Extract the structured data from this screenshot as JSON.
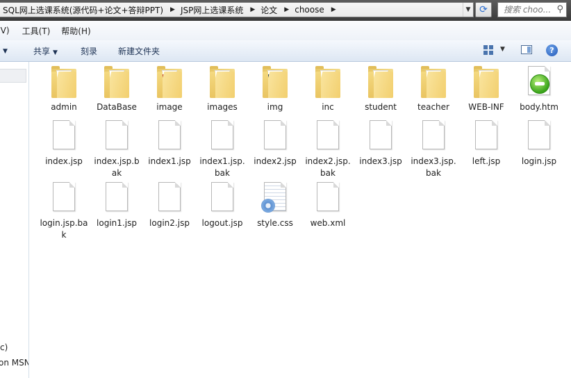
{
  "address": {
    "crumbs": [
      "SQL网上选课系统(源代码+论文+答辩PPT)",
      "JSP网上选课系统",
      "论文",
      "choose"
    ]
  },
  "search": {
    "placeholder": "搜索 choo..."
  },
  "menu": {
    "view": "(V)",
    "tools": "工具(T)",
    "help": "帮助(H)"
  },
  "toolbar": {
    "share": "共享",
    "burn": "刻录",
    "new_folder": "新建文件夹"
  },
  "nav": {
    "text1": "c)",
    "text2": "on MSN"
  },
  "files": [
    {
      "name": "admin",
      "kind": "folder"
    },
    {
      "name": "DataBase",
      "kind": "folder"
    },
    {
      "name": "image",
      "kind": "folder"
    },
    {
      "name": "images",
      "kind": "folder"
    },
    {
      "name": "img",
      "kind": "folder"
    },
    {
      "name": "inc",
      "kind": "folder"
    },
    {
      "name": "student",
      "kind": "folder"
    },
    {
      "name": "teacher",
      "kind": "folder"
    },
    {
      "name": "WEB-INF",
      "kind": "folder"
    },
    {
      "name": "body.htm",
      "kind": "htm"
    },
    {
      "name": "index.jsp",
      "kind": "file"
    },
    {
      "name": "index.jsp.bak",
      "kind": "file"
    },
    {
      "name": "index1.jsp",
      "kind": "file"
    },
    {
      "name": "index1.jsp.bak",
      "kind": "file"
    },
    {
      "name": "index2.jsp",
      "kind": "file"
    },
    {
      "name": "index2.jsp.bak",
      "kind": "file"
    },
    {
      "name": "index3.jsp",
      "kind": "file"
    },
    {
      "name": "index3.jsp.bak",
      "kind": "file"
    },
    {
      "name": "left.jsp",
      "kind": "file"
    },
    {
      "name": "login.jsp",
      "kind": "file"
    },
    {
      "name": "login.jsp.bak",
      "kind": "file"
    },
    {
      "name": "login1.jsp",
      "kind": "file"
    },
    {
      "name": "login2.jsp",
      "kind": "file"
    },
    {
      "name": "logout.jsp",
      "kind": "file"
    },
    {
      "name": "style.css",
      "kind": "css"
    },
    {
      "name": "web.xml",
      "kind": "file"
    }
  ]
}
